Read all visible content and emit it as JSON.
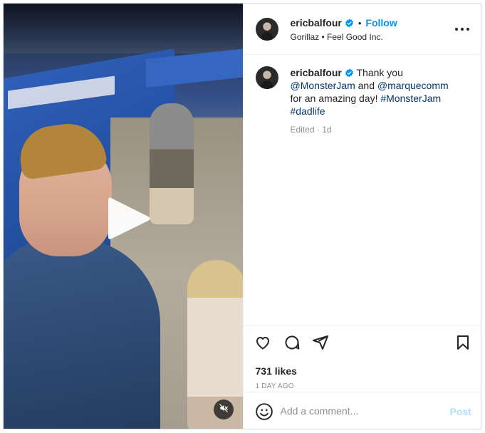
{
  "post": {
    "author": {
      "username": "ericbalfour",
      "follow_label": "Follow",
      "audio": "Gorillaz • Feel Good Inc."
    },
    "caption": {
      "username": "ericbalfour",
      "text_1": "Thank you",
      "mention_1": "@MonsterJam",
      "text_2": "and",
      "mention_2": "@marquecomm",
      "text_3": "for an amazing day!",
      "hashtag_1": "#MonsterJam",
      "hashtag_2": "#dadlife",
      "edited": "Edited · 1d"
    },
    "likes": "731 likes",
    "date": "1 DAY AGO",
    "comment": {
      "placeholder": "Add a comment...",
      "post_label": "Post"
    }
  },
  "icons": {
    "verified": "verified-badge-icon",
    "more": "more-options-icon",
    "like": "heart-icon",
    "comment": "comment-icon",
    "share": "share-icon",
    "save": "bookmark-icon",
    "emoji": "emoji-icon",
    "play": "play-icon",
    "mute": "muted-icon"
  },
  "colors": {
    "accent": "#0095f6",
    "link": "#00376b",
    "muted_text": "#8e8e8e",
    "post_disabled": "#b2dffc"
  }
}
